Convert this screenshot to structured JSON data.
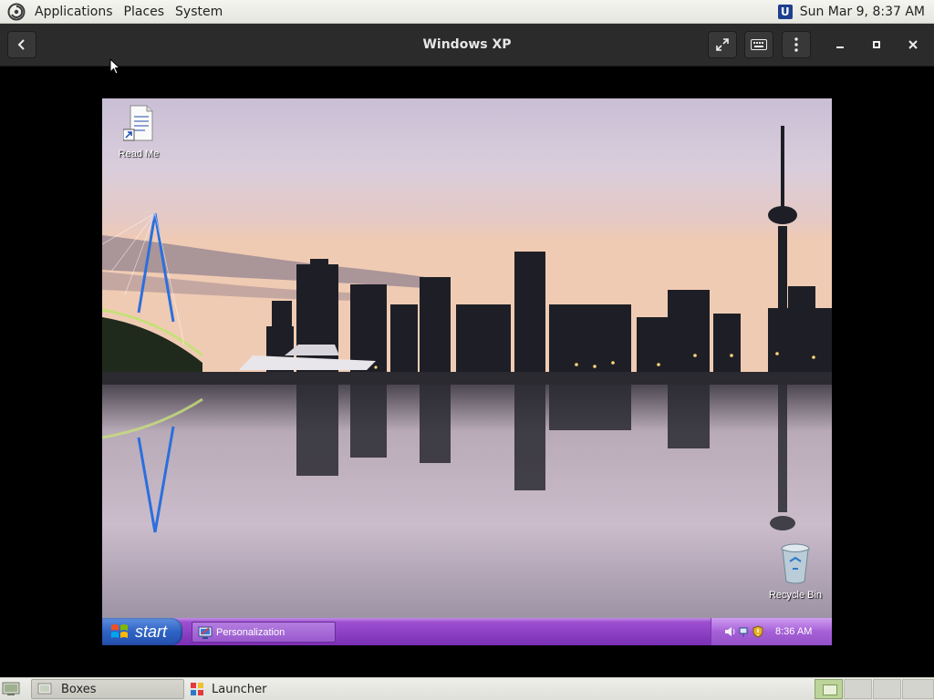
{
  "top_panel": {
    "menus": [
      "Applications",
      "Places",
      "System"
    ],
    "datetime": "Sun Mar 9,  8:37 AM",
    "applet_icon": "updates-icon"
  },
  "boxes_header": {
    "title": "Windows XP",
    "buttons": [
      "back-icon",
      "fullscreen-icon",
      "keyboard-icon",
      "kebab-menu-icon",
      "minimize-icon",
      "maximize-icon",
      "close-icon"
    ]
  },
  "vm": {
    "desktop_icons": {
      "readme": "Read Me",
      "recycle": "Recycle Bin"
    },
    "taskbar": {
      "start_label": "start",
      "task_label": "Personalization",
      "clock": "8:36 AM"
    }
  },
  "bottom_panel": {
    "tasks": [
      "Boxes",
      "Launcher"
    ]
  },
  "colors": {
    "taskbar_purple": "#8a3fc2",
    "start_blue": "#2f63c4",
    "header_dark": "#2b2b2b"
  }
}
